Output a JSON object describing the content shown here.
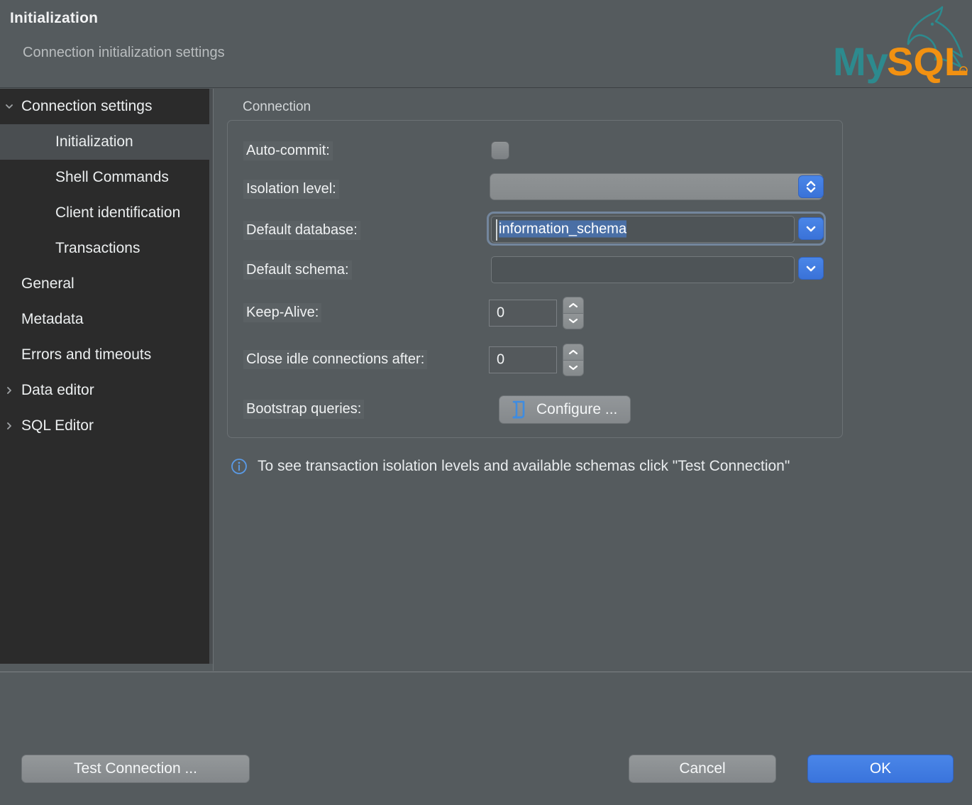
{
  "header": {
    "title": "Initialization",
    "subtitle": "Connection initialization settings",
    "logo_name": "mysql-logo",
    "logo_text_primary": "My",
    "logo_text_secondary": "SQL",
    "logo_color_teal": "#2d8a8e",
    "logo_color_orange": "#f29111"
  },
  "sidebar": {
    "items": [
      {
        "label": "Connection settings",
        "level": 0,
        "twisty": "chevron-down",
        "selected": false
      },
      {
        "label": "Initialization",
        "level": 1,
        "twisty": "",
        "selected": true
      },
      {
        "label": "Shell Commands",
        "level": 1,
        "twisty": "",
        "selected": false
      },
      {
        "label": "Client identification",
        "level": 1,
        "twisty": "",
        "selected": false
      },
      {
        "label": "Transactions",
        "level": 1,
        "twisty": "",
        "selected": false
      },
      {
        "label": "General",
        "level": 0,
        "twisty": "",
        "selected": false
      },
      {
        "label": "Metadata",
        "level": 0,
        "twisty": "",
        "selected": false
      },
      {
        "label": "Errors and timeouts",
        "level": 0,
        "twisty": "",
        "selected": false
      },
      {
        "label": "Data editor",
        "level": 0,
        "twisty": "chevron-right",
        "selected": false
      },
      {
        "label": "SQL Editor",
        "level": 0,
        "twisty": "chevron-right",
        "selected": false
      }
    ]
  },
  "main": {
    "group_title": "Connection",
    "fields": {
      "auto_commit_label": "Auto-commit:",
      "auto_commit_checked": false,
      "isolation_label": "Isolation level:",
      "isolation_value": "",
      "default_database_label": "Default database:",
      "default_database_value": "information_schema",
      "default_schema_label": "Default schema:",
      "default_schema_value": "",
      "keep_alive_label": "Keep-Alive:",
      "keep_alive_value": "0",
      "close_idle_label": "Close idle connections after:",
      "close_idle_value": "0",
      "bootstrap_label": "Bootstrap queries:",
      "configure_button_label": "Configure ..."
    },
    "info": {
      "icon": "info-icon",
      "text": "To see transaction isolation levels and available schemas click \"Test Connection\""
    }
  },
  "footer": {
    "test_connection_label": "Test Connection ...",
    "cancel_label": "Cancel",
    "ok_label": "OK"
  },
  "colors": {
    "accent_blue": "#4a86e8",
    "selection_blue": "#4a6fa5",
    "window_bg": "#555b5e",
    "sidebar_bg": "#2b2b2b",
    "sidebar_selected": "#4a4e51"
  }
}
